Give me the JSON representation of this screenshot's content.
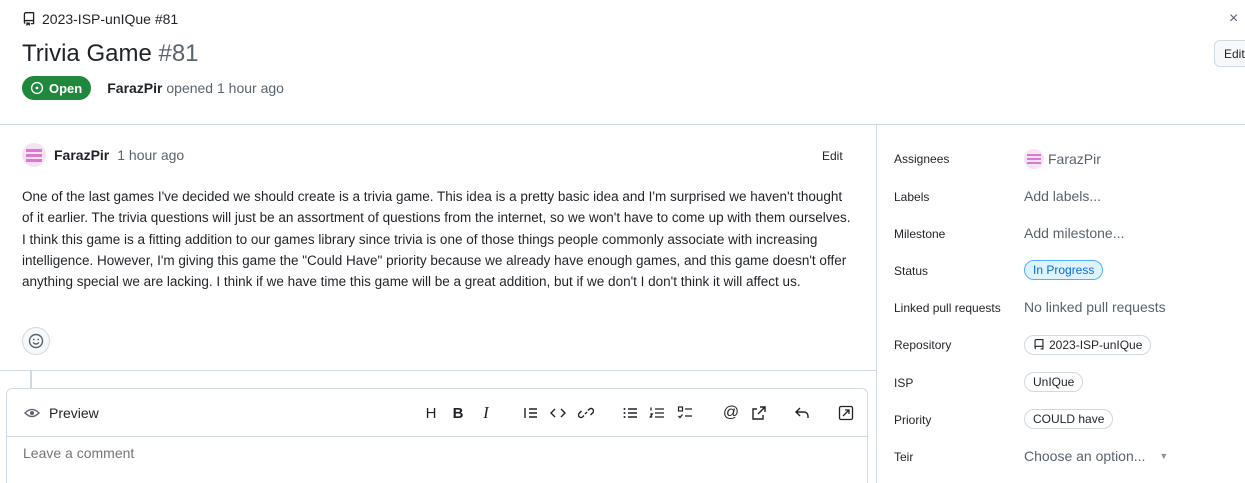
{
  "header": {
    "repo_ref": "2023-ISP-unIQue #81",
    "title": "Trivia Game",
    "number": "#81",
    "state": "Open",
    "author": "FarazPir",
    "opened_text": "opened 1 hour ago",
    "edit_label": "Edit",
    "close_icon": "×"
  },
  "comment": {
    "author": "FarazPir",
    "time": "1 hour ago",
    "edit_label": "Edit",
    "body": "One of the last games I've decided we should create is a trivia game. This idea is a pretty basic idea and I'm surprised we haven't thought of it earlier. The trivia questions will just be an assortment of questions from the internet, so we won't have to come up with them ourselves. I think this game is a fitting addition to our games library since trivia is one of those things people commonly associate with increasing intelligence. However, I'm giving this game the \"Could Have\" priority because we already have enough games, and this game doesn't offer anything special we are lacking. I think if we have time this game will be a great addition, but if we don't I don't think it will affect us."
  },
  "composer": {
    "preview_label": "Preview",
    "placeholder": "Leave a comment",
    "toolbar": [
      "heading-icon",
      "bold-icon",
      "italic-icon",
      "quote-icon",
      "code-icon",
      "link-icon",
      "unordered-list-icon",
      "ordered-list-icon",
      "task-list-icon",
      "mention-icon",
      "cross-reference-icon",
      "reply-icon",
      "fullscreen-icon"
    ]
  },
  "sidebar": {
    "assignees_label": "Assignees",
    "assignee": "FarazPir",
    "labels_label": "Labels",
    "labels_value": "Add labels...",
    "milestone_label": "Milestone",
    "milestone_value": "Add milestone...",
    "status_label": "Status",
    "status_value": "In Progress",
    "linked_label": "Linked pull requests",
    "linked_value": "No linked pull requests",
    "repository_label": "Repository",
    "repository_value": "2023-ISP-unIQue",
    "isp_label": "ISP",
    "isp_value": "UnIQue",
    "priority_label": "Priority",
    "priority_value": "COULD have",
    "teir_label": "Teir",
    "teir_value": "Choose an option..."
  },
  "colors": {
    "open_green": "#1f883d",
    "status_blue": "#0969da",
    "border": "#d1d9e0",
    "muted_text": "#59636e"
  }
}
